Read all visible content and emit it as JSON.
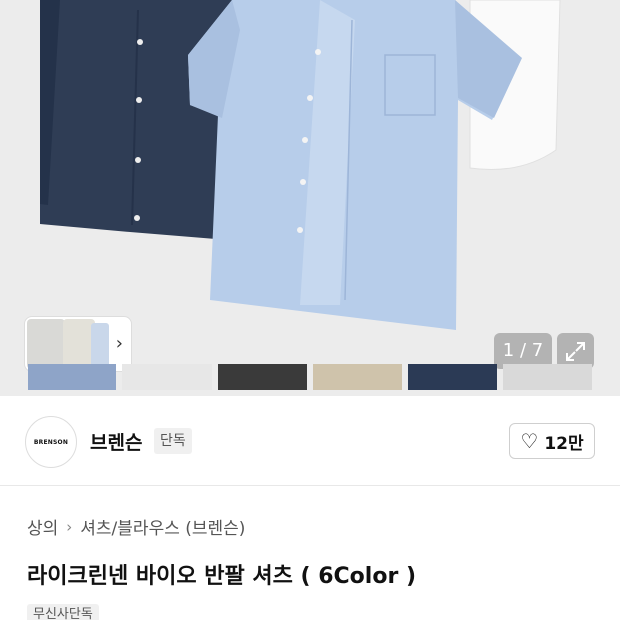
{
  "gallery": {
    "counter_current": "1",
    "counter_separator": "/",
    "counter_total": "7",
    "icons": {
      "thumbnail_next": "chevron-right-icon",
      "expand": "expand-icon"
    },
    "color_swatches": [
      "#8ea4c8",
      "#e7e7e7",
      "#3a3a3a",
      "#cfc3ab",
      "#2b3a55",
      "#d9d9d9"
    ]
  },
  "brand": {
    "logo_text": "BRENSON",
    "name": "브렌슨",
    "exclusive_tag": "단독",
    "like_icon": "heart-icon",
    "like_count": "12만"
  },
  "breadcrumb": {
    "category": "상의",
    "subcategory": "셔츠/블라우스 (브렌슨)",
    "separator_icon": "chevron-right-icon"
  },
  "product": {
    "title": "라이크린넨 바이오 반팔 셔츠 ( 6Color )",
    "badge": "무신사단독"
  }
}
